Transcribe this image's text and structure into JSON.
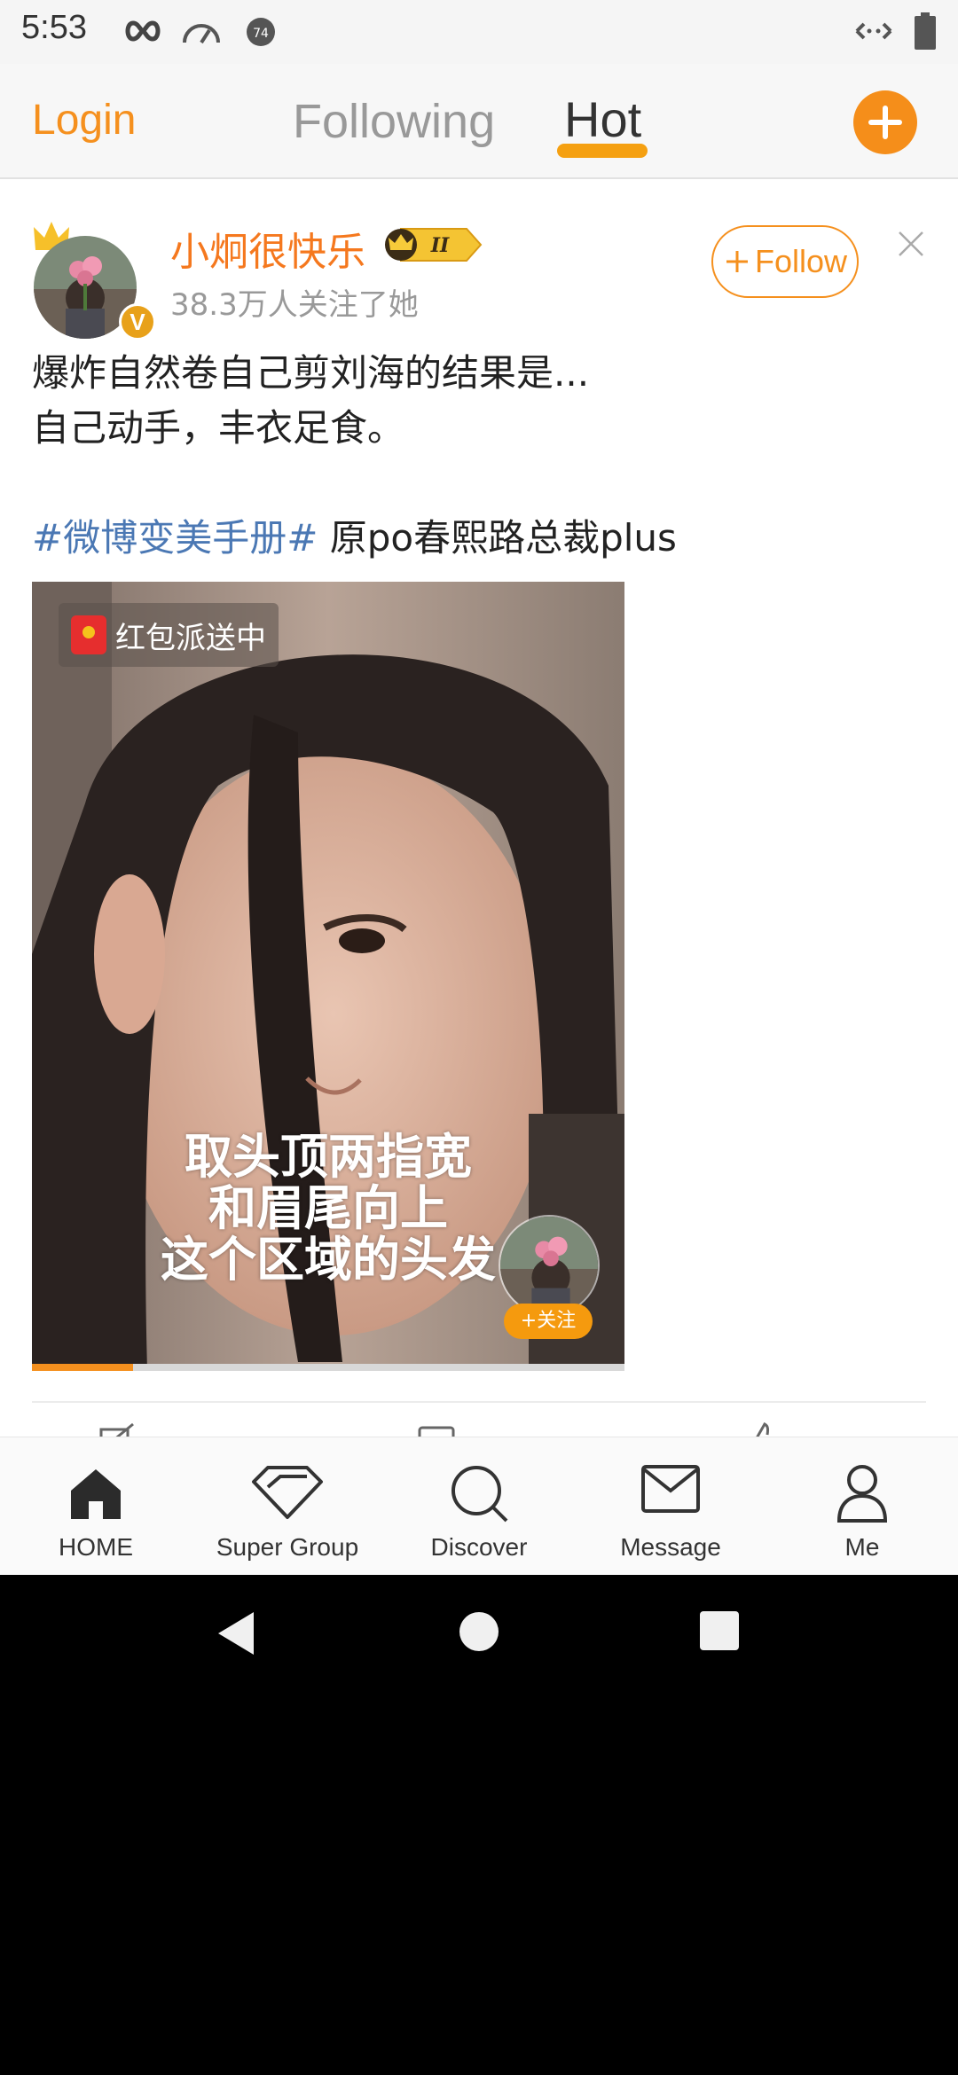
{
  "status_bar": {
    "time": "5:53",
    "icons": [
      "infinity-icon",
      "speedometer-icon",
      "notification-badge-icon",
      "data-arrows-icon",
      "battery-icon"
    ],
    "badge_number": "74"
  },
  "top_nav": {
    "login": "Login",
    "tabs": [
      {
        "label": "Following",
        "active": false
      },
      {
        "label": "Hot",
        "active": true
      }
    ],
    "accent": "#f5901e"
  },
  "post": {
    "username": "小炯很快乐",
    "level": "II",
    "followers": "38.3万人关注了她",
    "follow_label": "Follow",
    "text_lines": [
      "爆炸自然卷自己剪刘海的结果是...",
      "自己动手，丰衣足食。"
    ],
    "hashtag": "#微博变美手册#",
    "text_suffix": " 原po春熙路总裁plus",
    "video": {
      "badge": "红包派送中",
      "caption_lines": [
        "取头顶两指宽",
        "和眉尾向上",
        "这个区域的头发"
      ],
      "mini_follow": "+关注",
      "progress": 0.17
    }
  },
  "tab_bar": [
    {
      "label": "HOME",
      "icon": "home-icon",
      "active": true
    },
    {
      "label": "Super Group",
      "icon": "diamond-icon",
      "active": false
    },
    {
      "label": "Discover",
      "icon": "search-icon",
      "active": false
    },
    {
      "label": "Message",
      "icon": "envelope-icon",
      "active": false
    },
    {
      "label": "Me",
      "icon": "person-icon",
      "active": false
    }
  ]
}
